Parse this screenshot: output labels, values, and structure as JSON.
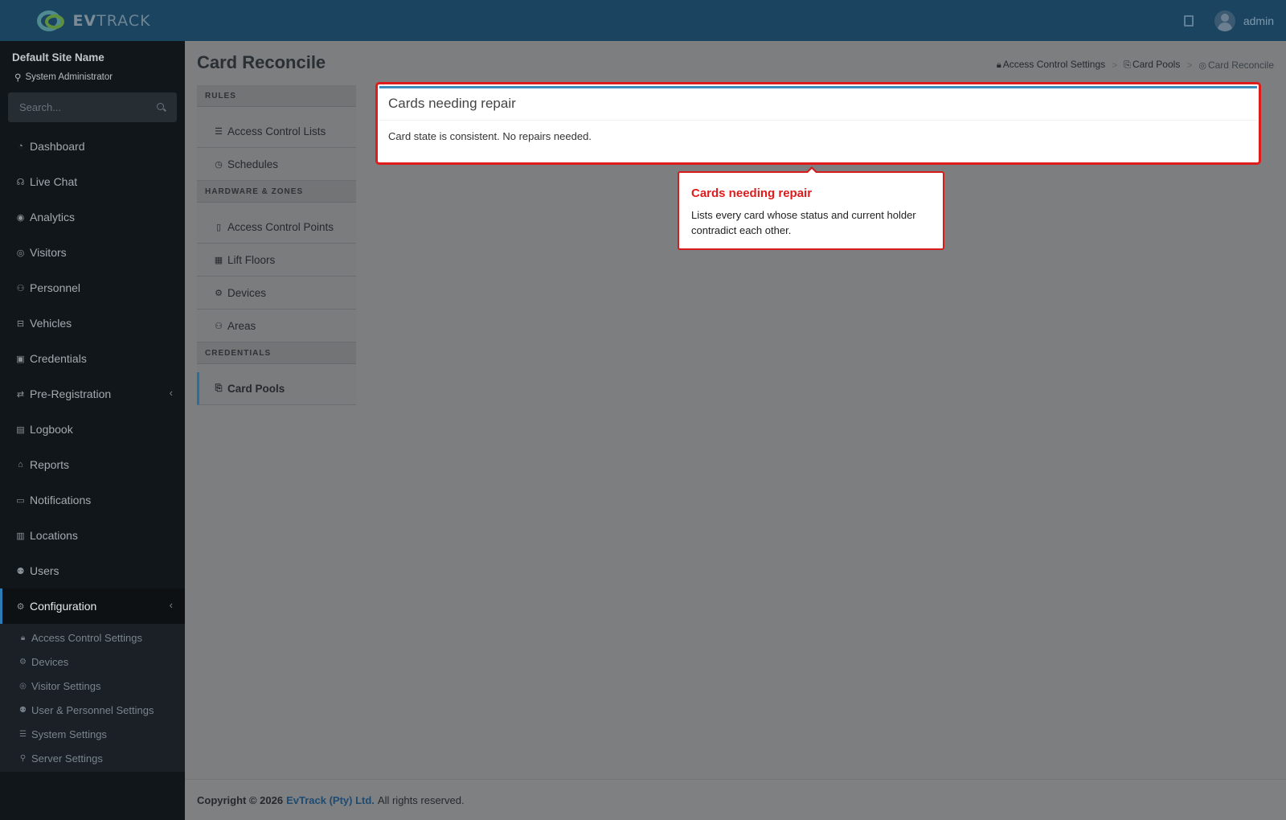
{
  "brand": {
    "name_bold": "EV",
    "name_rest": "TRACK"
  },
  "header": {
    "user": "admin"
  },
  "sidebar": {
    "site_name": "Default Site Name",
    "role": "System Administrator",
    "search_placeholder": "Search...",
    "items": [
      {
        "label": "Dashboard",
        "icon": "dashboard-icon"
      },
      {
        "label": "Live Chat",
        "icon": "headset-icon"
      },
      {
        "label": "Analytics",
        "icon": "analytics-icon"
      },
      {
        "label": "Visitors",
        "icon": "eye-icon"
      },
      {
        "label": "Personnel",
        "icon": "person-icon"
      },
      {
        "label": "Vehicles",
        "icon": "vehicle-icon"
      },
      {
        "label": "Credentials",
        "icon": "credentials-icon"
      },
      {
        "label": "Pre-Registration",
        "icon": "arrows-icon"
      },
      {
        "label": "Logbook",
        "icon": "logbook-icon"
      },
      {
        "label": "Reports",
        "icon": "reports-icon"
      },
      {
        "label": "Notifications",
        "icon": "chat-icon"
      },
      {
        "label": "Locations",
        "icon": "map-icon"
      },
      {
        "label": "Users",
        "icon": "user-gear-icon"
      },
      {
        "label": "Configuration",
        "icon": "gear-icon"
      }
    ],
    "subitems": [
      {
        "label": "Access Control Settings",
        "icon": "lock-icon"
      },
      {
        "label": "Devices",
        "icon": "gear-icon"
      },
      {
        "label": "Visitor Settings",
        "icon": "eye-icon"
      },
      {
        "label": "User & Personnel Settings",
        "icon": "user-gear-icon"
      },
      {
        "label": "System Settings",
        "icon": "sliders-icon"
      },
      {
        "label": "Server Settings",
        "icon": "server-icon"
      }
    ]
  },
  "page": {
    "title": "Card Reconcile",
    "breadcrumb": [
      "Access Control Settings",
      "Card Pools",
      "Card Reconcile"
    ],
    "breadcrumb_sep": ">"
  },
  "leftnav": {
    "rules_header": "RULES",
    "rules": [
      "Access Control Lists",
      "Schedules"
    ],
    "hardware_header": "HARDWARE & ZONES",
    "hardware": [
      "Access Control Points",
      "Lift Floors",
      "Devices",
      "Areas"
    ],
    "credentials_header": "CREDENTIALS",
    "credentials": [
      "Card Pools"
    ]
  },
  "card": {
    "title": "Cards needing repair",
    "body": "Card state is consistent. No repairs needed."
  },
  "tooltip": {
    "title": "Cards needing repair",
    "text": "Lists every card whose status and current holder contradict each other."
  },
  "footer": {
    "copyright": "Copyright © 2026",
    "company": "EvTrack (Pty) Ltd.",
    "rights": "All rights reserved."
  },
  "colors": {
    "accent": "#3c8dbc",
    "highlight": "#e01b1b",
    "header": "#1b4461"
  }
}
